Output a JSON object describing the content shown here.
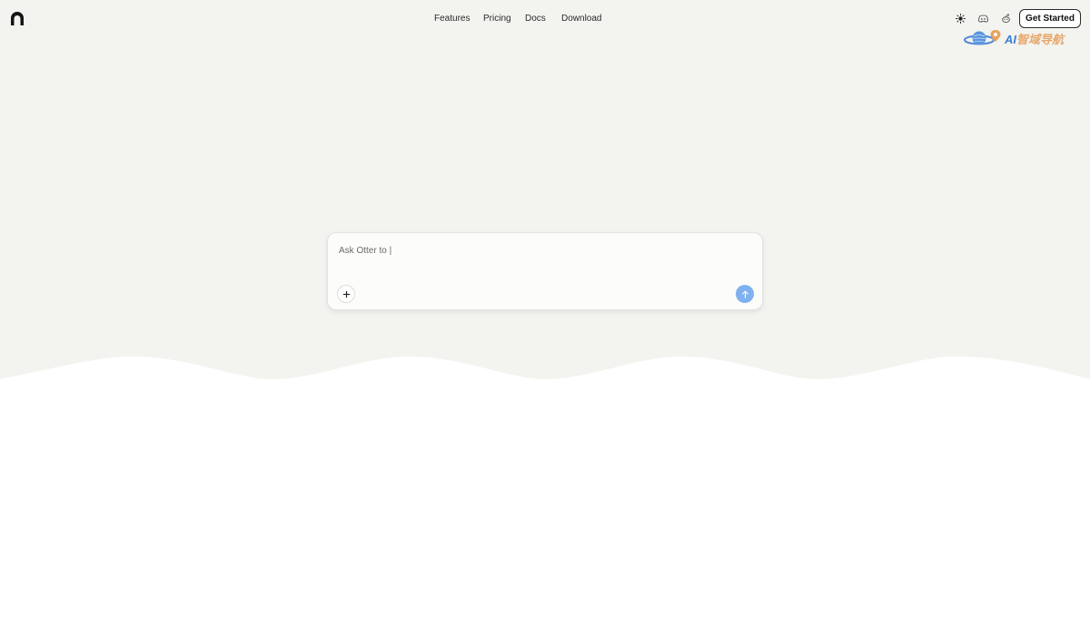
{
  "header": {
    "logo_icon": "otter-arch-logo-icon",
    "nav": [
      {
        "label": "Features"
      },
      {
        "label": "Pricing"
      },
      {
        "label": "Docs"
      },
      {
        "label": "Download"
      }
    ],
    "icons": [
      "sun-icon",
      "discord-icon",
      "reddit-icon"
    ],
    "cta_label": "Get Started"
  },
  "watermark": {
    "text_ai": "AI",
    "text_cn": "智域导航"
  },
  "prompt": {
    "placeholder": "Ask Otter to |",
    "attach_icon": "plus-icon",
    "send_icon": "arrow-up-icon"
  },
  "colors": {
    "hero_bg": "#f3f3ef",
    "page_bg": "#ffffff",
    "send_accent": "#7fb0f0"
  }
}
